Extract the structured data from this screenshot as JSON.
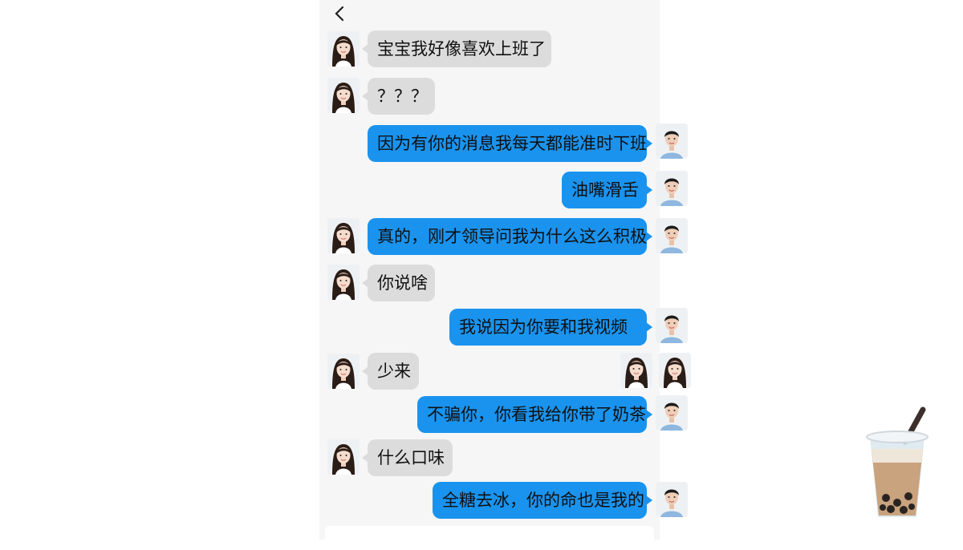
{
  "chat": {
    "messages": [
      {
        "text": "宝宝我好像喜欢上班了",
        "sender": "her"
      },
      {
        "text": "？？？",
        "sender": "her"
      },
      {
        "text": "因为有你的消息我每天都能准时下班",
        "sender": "me"
      },
      {
        "text": "油嘴滑舌",
        "sender": "me"
      },
      {
        "text": "真的，刚才领导问我为什么这么积极",
        "sender": "me"
      },
      {
        "text": "你说啥",
        "sender": "her"
      },
      {
        "text": "我说因为你要和我视频",
        "sender": "me"
      },
      {
        "text": "少来",
        "sender": "her"
      },
      {
        "text": "不骗你，你看我给你带了奶茶",
        "sender": "me"
      },
      {
        "text": "什么口味",
        "sender": "her"
      },
      {
        "text": "全糖去冰，你的命也是我的",
        "sender": "me"
      }
    ]
  },
  "colors": {
    "outgoing_bubble": "#1a93ee",
    "incoming_bubble": "#dcdcdc",
    "background": "#f6f6f6"
  },
  "icons": {
    "back": "chevron-left-icon",
    "decoration": "bubble-tea-icon"
  }
}
